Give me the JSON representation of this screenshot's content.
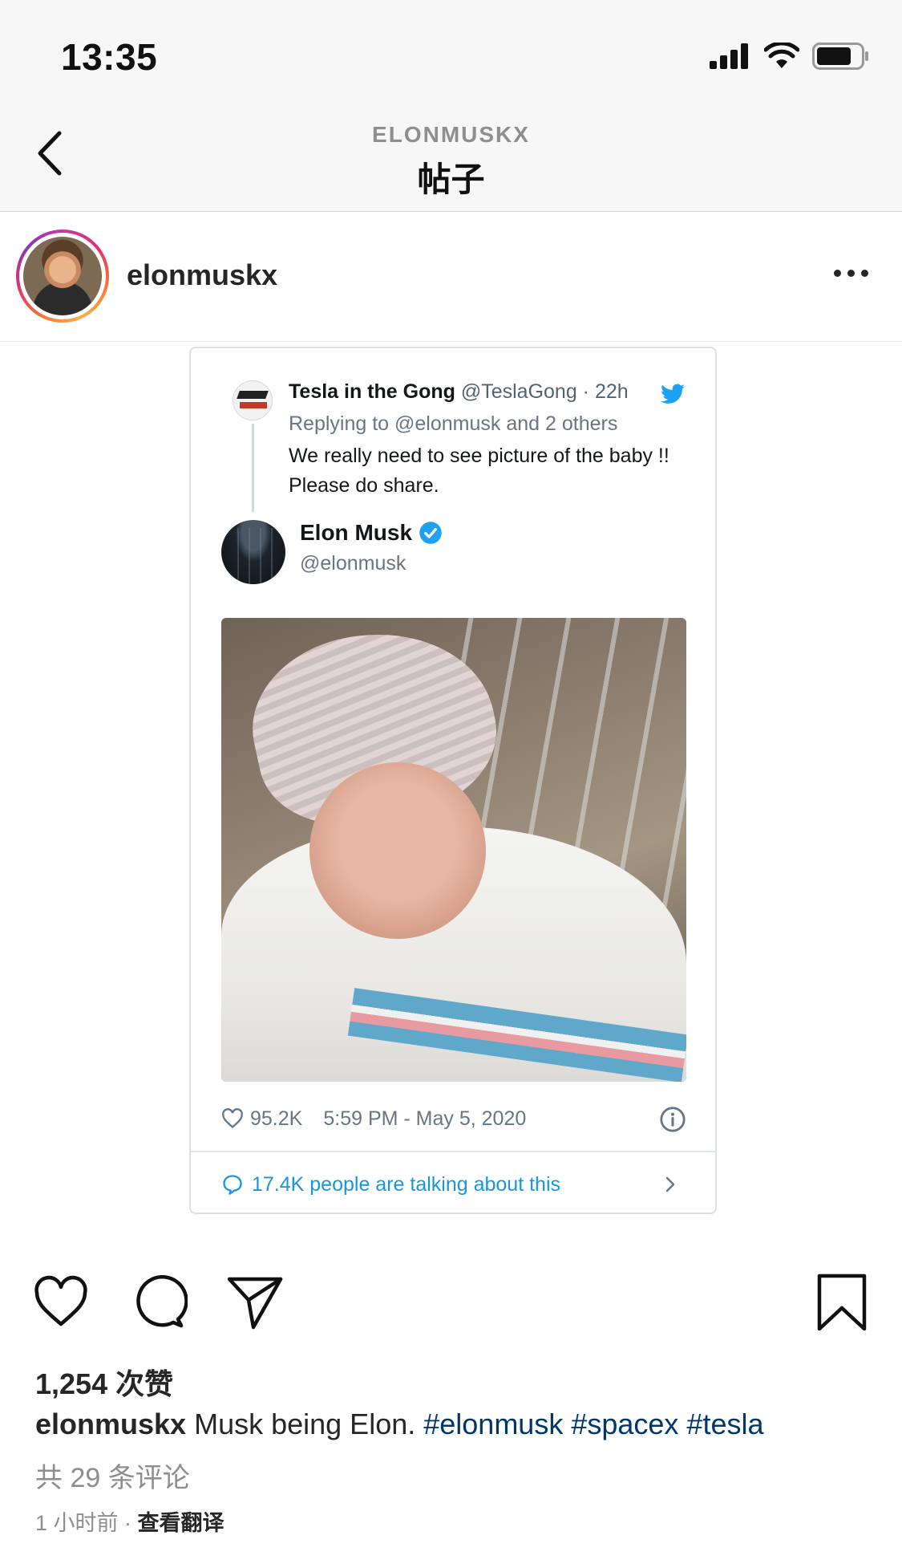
{
  "status_bar": {
    "time": "13:35"
  },
  "nav": {
    "subtitle": "ELONMUSKX",
    "title": "帖子"
  },
  "post": {
    "username": "elonmuskx"
  },
  "tweet": {
    "reply": {
      "name": "Tesla in the Gong",
      "handle_time": "@TeslaGong · 22h",
      "replying_to": "Replying to @elonmusk and 2 others",
      "text": "We really need to see picture of the baby !! Please do share."
    },
    "author": {
      "name": "Elon Musk",
      "handle": "@elonmusk"
    },
    "likes": "95.2K",
    "timestamp": "5:59 PM - May 5, 2020",
    "talking": "17.4K people are talking about this"
  },
  "engagement": {
    "likes": "1,254 次赞",
    "caption_user": "elonmuskx",
    "caption_text": " Musk being Elon. ",
    "caption_tags": "#elonmusk #spacex #tesla",
    "comments": "共 29 条评论",
    "time": "1 小时前 · ",
    "translate": "查看翻译"
  },
  "colors": {
    "accent_link": "#00376b",
    "twitter_blue": "#1da1f2",
    "muted": "#8e8e8e"
  },
  "icons": [
    "back-chevron-icon",
    "signal-icon",
    "wifi-icon",
    "battery-icon",
    "more-icon",
    "twitter-bird-icon",
    "verified-icon",
    "heart-icon",
    "comment-icon",
    "share-icon",
    "bookmark-icon",
    "info-icon",
    "chevron-right-icon"
  ]
}
